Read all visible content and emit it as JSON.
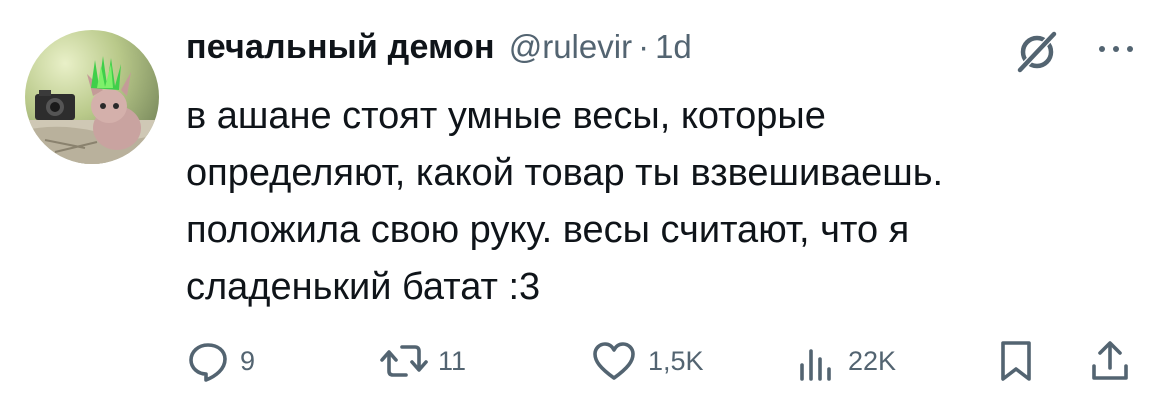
{
  "tweet": {
    "display_name": "печальный демон",
    "handle": "@rulevir",
    "separator": "·",
    "time": "1d",
    "text": "в ашане стоят умные весы, которые\nопределяют, какой товар ты взвешиваешь.\nположила свою руку. весы считают, что я\nсладенький батат :3",
    "actions": {
      "reply": "9",
      "retweet": "11",
      "like": "1,5K",
      "views": "22K"
    }
  },
  "icons": {
    "grok": "grok-icon",
    "more": "more-icon",
    "reply": "reply-icon",
    "retweet": "retweet-icon",
    "like": "heart-icon",
    "views": "views-icon",
    "bookmark": "bookmark-icon",
    "share": "share-icon"
  },
  "colors": {
    "text": "#0f1419",
    "secondary": "#536471"
  }
}
